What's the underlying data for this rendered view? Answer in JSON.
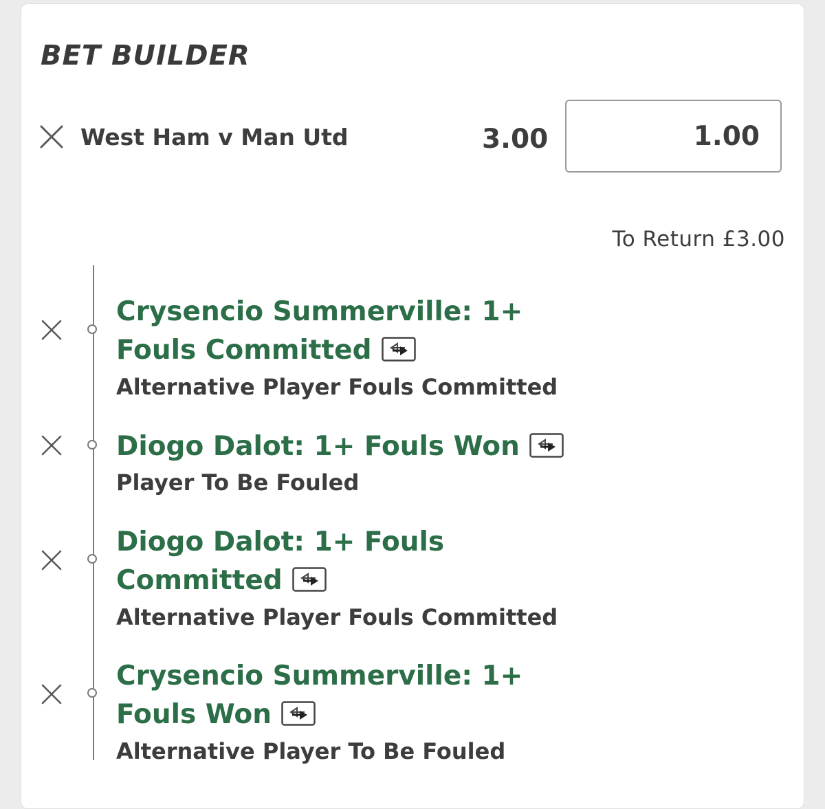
{
  "bet_builder": {
    "title": "BET BUILDER",
    "event": "West Ham v Man Utd",
    "odds": "3.00",
    "stake_value": "1.00",
    "to_return": "To Return £3.00"
  },
  "selections": [
    {
      "title_line1": "Crysencio Summerville: 1+",
      "title_line2": "Fouls Committed",
      "market": "Alternative Player Fouls Committed"
    },
    {
      "title_line1": "Diogo Dalot: 1+ Fouls Won",
      "title_line2": "",
      "market": "Player To Be Fouled"
    },
    {
      "title_line1": "Diogo Dalot: 1+ Fouls",
      "title_line2": "Committed",
      "market": "Alternative Player Fouls Committed"
    },
    {
      "title_line1": "Crysencio Summerville: 1+",
      "title_line2": "Fouls Won",
      "market": "Alternative Player To Be Fouled"
    }
  ],
  "icons": {
    "remove": "close-icon",
    "swap": "swap-icon"
  },
  "colors": {
    "selection_text": "#2b6e47",
    "primary_text": "#3d3d3d",
    "timeline": "#7a7a7a"
  }
}
